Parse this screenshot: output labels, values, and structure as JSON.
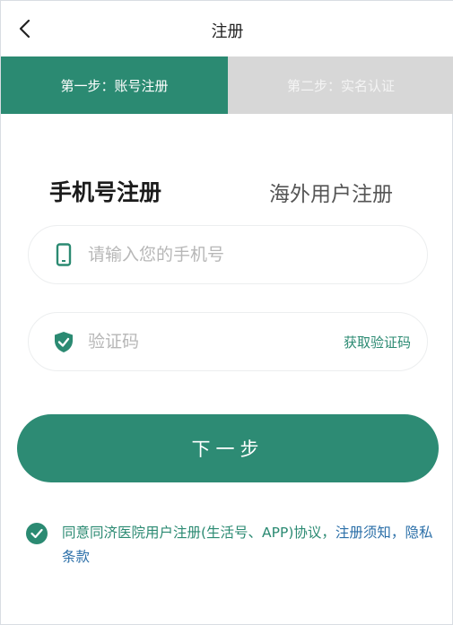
{
  "nav": {
    "title": "注册"
  },
  "steps": [
    {
      "label": "第一步：账号注册"
    },
    {
      "label": "第二步：实名认证"
    }
  ],
  "tabs": {
    "primary": "手机号注册",
    "secondary": "海外用户注册"
  },
  "phone_field": {
    "placeholder": "请输入您的手机号"
  },
  "code_field": {
    "placeholder": "验证码",
    "get_code_label": "获取验证码"
  },
  "next_button": {
    "label": "下一步"
  },
  "agreement": {
    "text": "同意同济医院用户注册(生活号、APP)协议，",
    "link1": "注册须知",
    "separator": "，",
    "link2": "隐私条款"
  },
  "colors": {
    "accent": "#2b8a72",
    "inactive_step": "#d7d7d7",
    "link": "#2b6fa8"
  }
}
